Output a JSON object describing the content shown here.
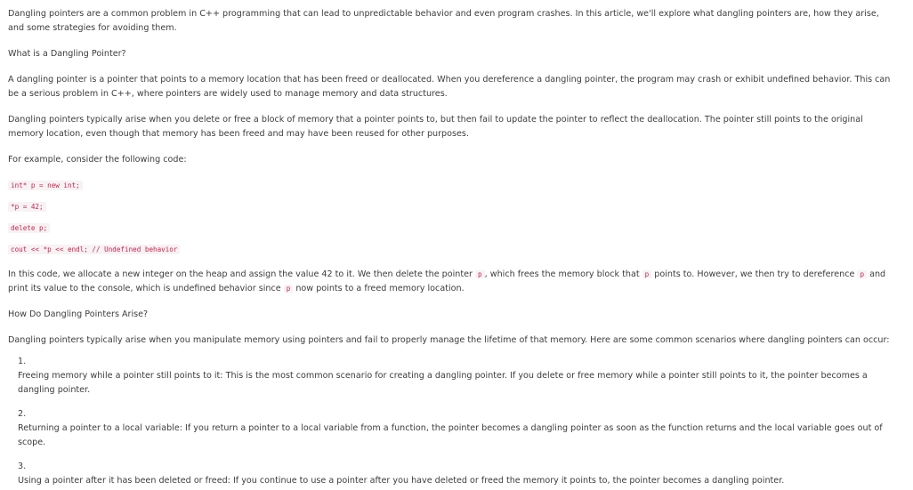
{
  "article": {
    "intro": "Dangling pointers are a common problem in C++ programming that can lead to unpredictable behavior and even program crashes. In this article, we'll explore what dangling pointers are, how they arise, and some strategies for avoiding them.",
    "heading1": "What is a Dangling Pointer?",
    "para1": "A dangling pointer is a pointer that points to a memory location that has been freed or deallocated. When you dereference a dangling pointer, the program may crash or exhibit undefined behavior. This can be a serious problem in C++, where pointers are widely used to manage memory and data structures.",
    "para2": "Dangling pointers typically arise when you delete or free a block of memory that a pointer points to, but then fail to update the pointer to reflect the deallocation. The pointer still points to the original memory location, even though that memory has been freed and may have been reused for other purposes.",
    "example_intro": "For example, consider the following code:",
    "code": [
      "int* p = new int;",
      "*p = 42;",
      "delete p;",
      "cout << *p << endl; // Undefined behavior"
    ],
    "explain": {
      "part1": "In this code, we allocate a new integer on the heap and assign the value 42 to it. We then delete the pointer ",
      "var1": "p",
      "part2": ", which frees the memory block that ",
      "var2": "p",
      "part3": " points to. However, we then try to dereference ",
      "var3": "p",
      "part4": " and print its value to the console, which is undefined behavior since ",
      "var4": "p",
      "part5": " now points to a freed memory location."
    },
    "heading2": "How Do Dangling Pointers Arise?",
    "para3": "Dangling pointers typically arise when you manipulate memory using pointers and fail to properly manage the lifetime of that memory. Here are some common scenarios where dangling pointers can occur:",
    "list": [
      {
        "number": "1.",
        "text": "Freeing memory while a pointer still points to it: This is the most common scenario for creating a dangling pointer. If you delete or free memory while a pointer still points to it, the pointer becomes a dangling pointer."
      },
      {
        "number": "2.",
        "text": "Returning a pointer to a local variable: If you return a pointer to a local variable from a function, the pointer becomes a dangling pointer as soon as the function returns and the local variable goes out of scope."
      },
      {
        "number": "3.",
        "text": "Using a pointer after it has been deleted or freed: If you continue to use a pointer after you have deleted or freed the memory it points to, the pointer becomes a dangling pointer."
      }
    ]
  }
}
